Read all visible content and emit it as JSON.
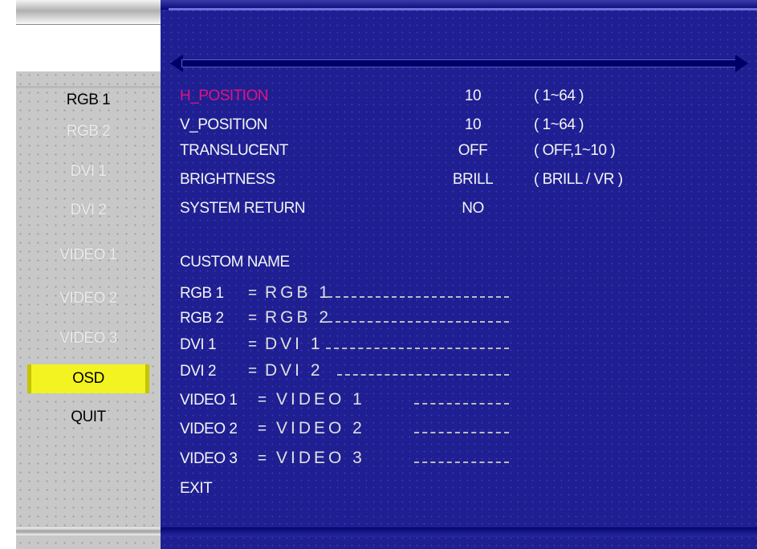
{
  "sidebar": {
    "items": [
      {
        "label": "RGB 1",
        "state": "active"
      },
      {
        "label": "RGB 2",
        "state": "inactive"
      },
      {
        "label": "DVI 1",
        "state": "inactive"
      },
      {
        "label": "DVI 2",
        "state": "inactive"
      },
      {
        "label": "VIDEO 1",
        "state": "inactive"
      },
      {
        "label": "VIDEO 2",
        "state": "inactive"
      },
      {
        "label": "VIDEO 3",
        "state": "inactive"
      },
      {
        "label": "OSD",
        "state": "selected"
      },
      {
        "label": "QUIT",
        "state": "active"
      }
    ]
  },
  "settings": [
    {
      "label": "H_POSITION",
      "value": "10",
      "range": "( 1~64 )",
      "highlight": true
    },
    {
      "label": "V_POSITION",
      "value": "10",
      "range": "( 1~64 )"
    },
    {
      "label": "TRANSLUCENT",
      "value": "OFF",
      "range": "( OFF,1~10 )"
    },
    {
      "label": "BRIGHTNESS",
      "value": "BRILL",
      "range": "( BRILL / VR )"
    },
    {
      "label": "SYSTEM RETURN",
      "value": "NO",
      "range": ""
    }
  ],
  "custom_name": {
    "title": "CUSTOM NAME",
    "entries": [
      {
        "label": "RGB 1",
        "eq": "=",
        "value": "RGB 1"
      },
      {
        "label": "RGB 2",
        "eq": "=",
        "value": "RGB 2"
      },
      {
        "label": "DVI 1",
        "eq": "=",
        "value": "DVI 1"
      },
      {
        "label": "DVI 2",
        "eq": "=",
        "value": "DVI 2"
      },
      {
        "label": "VIDEO 1",
        "eq": "=",
        "value": "VIDEO 1"
      },
      {
        "label": "VIDEO 2",
        "eq": "=",
        "value": "VIDEO 2"
      },
      {
        "label": "VIDEO 3",
        "eq": "=",
        "value": "VIDEO 3"
      }
    ]
  },
  "exit_label": "EXIT",
  "colors": {
    "panel_blue": "#1f1f9a",
    "highlight_magenta": "#e0147e",
    "selected_yellow": "#f3f322",
    "sidebar_gray": "#c8c8c8"
  }
}
